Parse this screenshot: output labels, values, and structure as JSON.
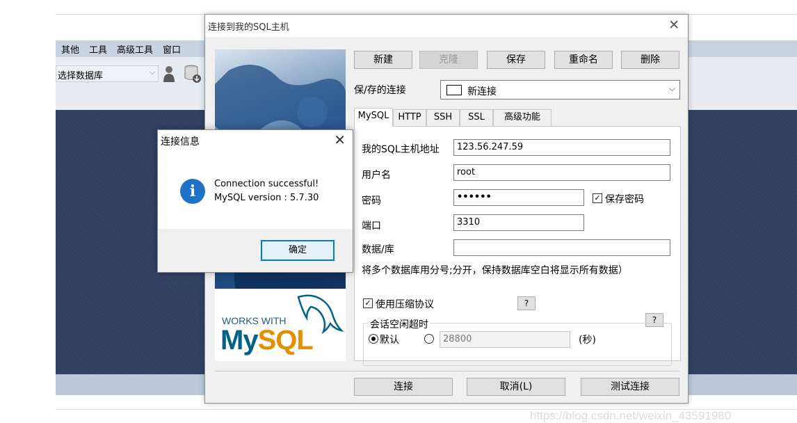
{
  "background_app": {
    "menu": [
      "其他",
      "工具",
      "高级工具",
      "窗口"
    ],
    "database_select": {
      "value": "选择数据库"
    },
    "watermark": "https://blog.csdn.net/weixin_43591980"
  },
  "dialog": {
    "title": "连接到我的SQL主机",
    "buttons": {
      "new": "新建",
      "clone": "克隆",
      "save": "保存",
      "rename": "重命名",
      "delete": "删除"
    },
    "saved_connection_label": "保/存的连接",
    "saved_connection_value": "新连接",
    "tabs": [
      "MySQL",
      "HTTP",
      "SSH",
      "SSL",
      "高级功能"
    ],
    "active_tab": "MySQL",
    "form": {
      "host_label": "我的SQL主机地址",
      "host_value": "123.56.247.59",
      "user_label": "用户名",
      "user_value": "root",
      "password_label": "密码",
      "password_value": "••••••",
      "save_password_label": "保存密码",
      "save_password_checked": true,
      "port_label": "端口",
      "port_value": "3310",
      "database_label": "数据/库",
      "database_value": "",
      "database_hint": "将多个数据库用分号;分开，保持数据库空白将显示所有数据）",
      "compression_label": "使用压缩协议",
      "compression_checked": true,
      "help_label": "?",
      "timeout_group_label": "会话空闲超时",
      "timeout_default_label": "默认",
      "timeout_default_selected": true,
      "timeout_value": "28800",
      "timeout_unit": "(秒)"
    },
    "footer_buttons": {
      "connect": "连接",
      "cancel": "取消(L)",
      "test": "测试连接"
    },
    "logo": {
      "works_with": "WORKS WITH",
      "my": "My",
      "sql": "SQL"
    }
  },
  "message_box": {
    "title": "连接信息",
    "icon": "info-icon",
    "line1": "Connection successful!",
    "line2": "MySQL version : 5.7.30",
    "ok": "确定"
  },
  "colors": {
    "accent": "#0078d7",
    "info_icon": "#1e72c8",
    "mysql_blue": "#00618a",
    "mysql_orange": "#e48e00",
    "app_dark_bg": "#2f4062"
  }
}
